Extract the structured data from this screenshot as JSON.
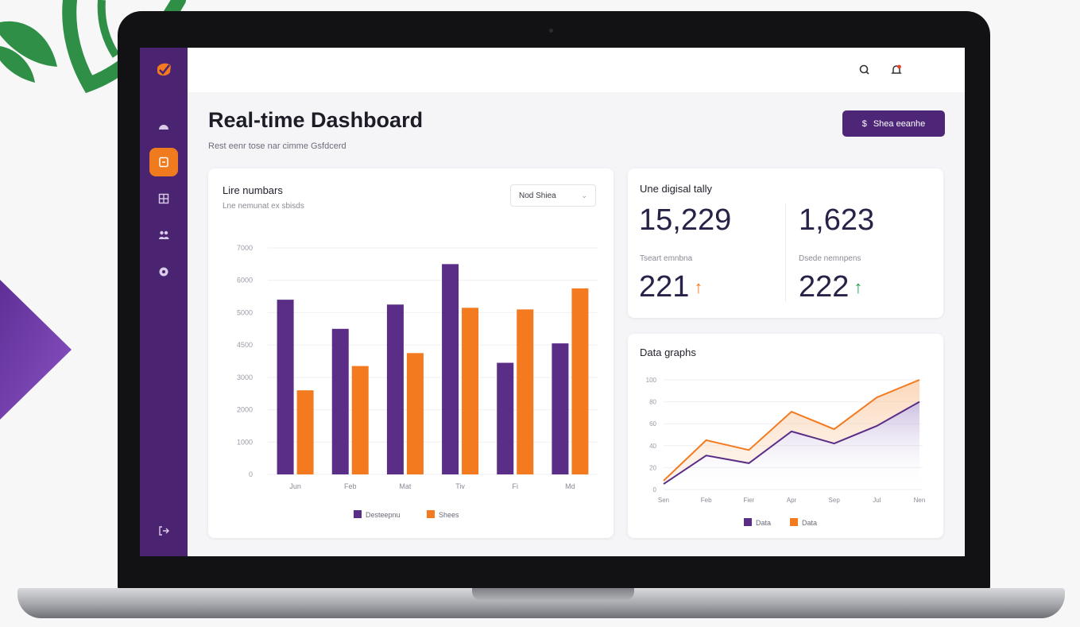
{
  "header": {
    "title": "Real-time Dashboard",
    "subtitle": "Rest eenr tose nar cimme Gsfdcerd",
    "action_button_icon": "$",
    "action_button_label": "Shea eeanhe"
  },
  "sidebar": {
    "items": [
      {
        "icon": "dashboard-icon",
        "active": false
      },
      {
        "icon": "document-icon",
        "active": true
      },
      {
        "icon": "grid-icon",
        "active": false
      },
      {
        "icon": "users-icon",
        "active": false
      },
      {
        "icon": "settings-icon",
        "active": false
      }
    ],
    "logout_icon": "logout-icon"
  },
  "topbar": {
    "icons": [
      "search-icon",
      "bell-icon"
    ],
    "avatar": "user-avatar"
  },
  "numbers_card": {
    "title": "Lire numbars",
    "subtitle": "Lne nemunat ex sbisds",
    "dropdown_value": "Nod Shiea",
    "dropdown_caret": "⌄"
  },
  "stats_card": {
    "title": "Une digisal tally",
    "stat1": "15,229",
    "stat2": "1,623",
    "label3": "Tseart emnbna",
    "label4": "Dsede nemnpens",
    "stat3": "221",
    "stat4": "222",
    "arrow3": "↑",
    "arrow4": "↑"
  },
  "graphs_card": {
    "title": "Data graphs"
  },
  "chart_data": [
    {
      "type": "bar",
      "categories": [
        "Jun",
        "Feb",
        "Mat",
        "Tiv",
        "Fi",
        "Md"
      ],
      "series": [
        {
          "name": "Desteepnu",
          "values": [
            54000,
            45000,
            52500,
            65000,
            34500,
            40500
          ]
        },
        {
          "name": "Shees",
          "values": [
            26000,
            33500,
            37500,
            51500,
            51000,
            57500
          ]
        }
      ],
      "ylim": [
        0,
        70000
      ],
      "yticks": [
        "0",
        "1000",
        "2000",
        "3000",
        "4500",
        "5000",
        "6000",
        "7000"
      ],
      "colors": [
        "#5a2d86",
        "#f47a20"
      ],
      "legend": "bottom",
      "grid": true
    },
    {
      "type": "area",
      "x": [
        "Sen",
        "Feb",
        "Fier",
        "Apr",
        "Sep",
        "Jul",
        "Nen"
      ],
      "series": [
        {
          "name": "Data",
          "values": [
            5,
            31,
            24,
            53,
            42,
            58,
            80
          ]
        },
        {
          "name": "Data",
          "values": [
            8,
            45,
            36,
            71,
            55,
            84,
            100
          ]
        }
      ],
      "ylim": [
        0,
        100
      ],
      "yticks": [
        "0",
        "20",
        "40",
        "60",
        "80",
        "100"
      ],
      "colors": [
        "#5a2d86",
        "#f47a20"
      ],
      "legend": "bottom",
      "grid": true
    }
  ]
}
